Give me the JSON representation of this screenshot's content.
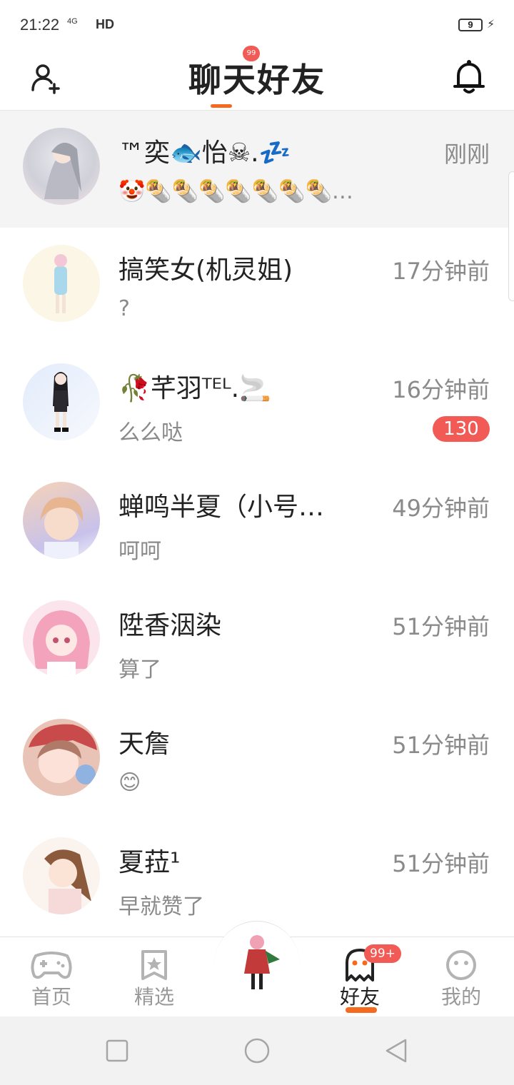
{
  "status_bar": {
    "time": "21:22",
    "network": "4G",
    "hd": "HD",
    "battery": "9"
  },
  "header": {
    "title": "聊天好友",
    "title_badge": "99"
  },
  "chats": [
    {
      "name": "™奕🐟怡☠.💤",
      "message": "🤡🌯🌯🌯🌯🌯🌯🌯…",
      "time": "刚刚",
      "badge": ""
    },
    {
      "name": "搞笑女(机灵姐)",
      "message": "?",
      "time": "17分钟前",
      "badge": ""
    },
    {
      "name": "🥀芊羽ᵀᴱᴸ.🚬",
      "message": "么么哒",
      "time": "16分钟前",
      "badge": "130"
    },
    {
      "name": "蝉鸣半夏（小号…",
      "message": "呵呵",
      "time": "49分钟前",
      "badge": ""
    },
    {
      "name": "陞香洇染",
      "message": "算了",
      "time": "51分钟前",
      "badge": ""
    },
    {
      "name": "天詹",
      "message": "😊",
      "time": "51分钟前",
      "badge": ""
    },
    {
      "name": "夏菈¹",
      "message": "早就赞了",
      "time": "51分钟前",
      "badge": ""
    }
  ],
  "bottom_nav": {
    "home": "首页",
    "featured": "精选",
    "friends": "好友",
    "friends_badge": "99+",
    "me": "我的"
  },
  "colors": {
    "accent": "#f46a1f",
    "badge": "#f15a55",
    "muted_text": "#8a8a8a"
  }
}
